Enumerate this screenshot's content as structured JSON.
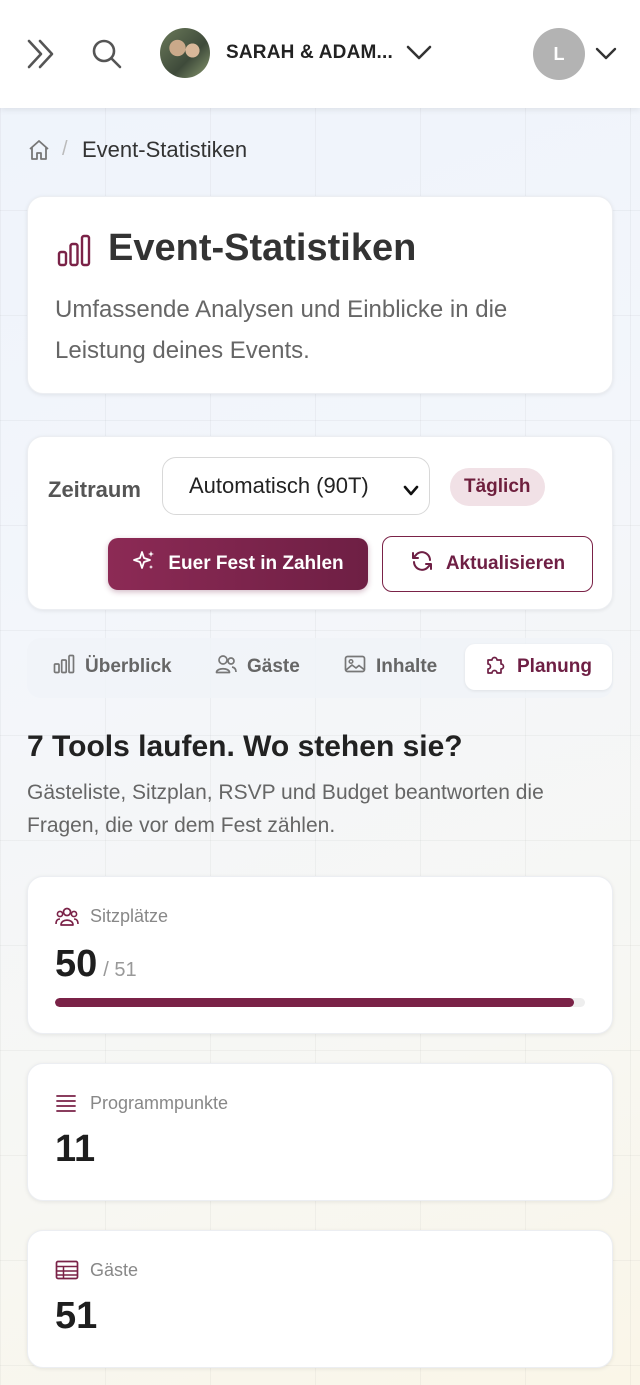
{
  "topbar": {
    "event_name": "SARAH & ADAM...",
    "user_initial": "L"
  },
  "breadcrumb": {
    "current": "Event-Statistiken"
  },
  "hero": {
    "title": "Event-Statistiken",
    "subtitle": "Umfassende Analysen und Einblicke in die Leistung deines Events."
  },
  "controls": {
    "period_label": "Zeitraum",
    "period_value": "Automatisch (90T)",
    "interval_badge": "Täglich",
    "primary_button": "Euer Fest in Zahlen",
    "refresh_button": "Aktualisieren"
  },
  "tabs": [
    {
      "label": "Überblick",
      "icon": "bar-chart-icon"
    },
    {
      "label": "Gäste",
      "icon": "users-icon"
    },
    {
      "label": "Inhalte",
      "icon": "image-icon"
    },
    {
      "label": "Planung",
      "icon": "puzzle-icon",
      "active": true
    }
  ],
  "section": {
    "title": "7 Tools laufen. Wo stehen sie?",
    "subtitle": "Gästeliste, Sitzplan, RSVP und Budget beantworten die Fragen, die vor dem Fest zählen."
  },
  "stats": [
    {
      "label": "Sitzplätze",
      "value": "50",
      "total": "/ 51",
      "progress": 0.98,
      "icon": "users-icon"
    },
    {
      "label": "Programmpunkte",
      "value": "11",
      "icon": "list-icon"
    },
    {
      "label": "Gäste",
      "value": "51",
      "icon": "table-icon"
    }
  ],
  "colors": {
    "accent": "#7a2247",
    "badge_bg": "#f1e1e6"
  }
}
